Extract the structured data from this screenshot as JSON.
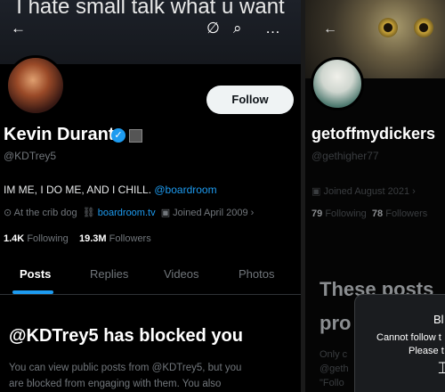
{
  "caption": "I hate small talk what u want",
  "left": {
    "header": {
      "back_icon": "←",
      "mute_icon": "∅",
      "search_icon": "⌕",
      "more_icon": "…"
    },
    "follow_label": "Follow",
    "name": "Kevin Durant",
    "verified_icon": "✓",
    "handle": "@KDTrey5",
    "bio_text": "IM ME, I DO ME, AND I CHILL.",
    "bio_mention": "@boardroom",
    "location": "At the crib dog",
    "website": "boardroom.tv",
    "joined": "Joined April 2009",
    "following_count": "1.4K",
    "following_label": "Following",
    "followers_count": "19.3M",
    "followers_label": "Followers",
    "tabs": [
      "Posts",
      "Replies",
      "Videos",
      "Photos"
    ],
    "blocked_title": "@KDTrey5 has blocked you",
    "blocked_body_l1": "You can view public posts from @KDTrey5, but you",
    "blocked_body_l2": "are blocked from engaging with them. You also"
  },
  "right": {
    "back_icon": "←",
    "name": "getoffmydickers",
    "handle": "@gethigher77",
    "joined": "Joined August 2021",
    "following_count": "79",
    "following_label": "Following",
    "followers_count": "78",
    "followers_label": "Followers",
    "big_line1": "These posts",
    "big_line2": "pro",
    "faint_l1": "Only c",
    "faint_l2": "@geth",
    "faint_l3": "\"Follo",
    "modal_title": "Bl",
    "modal_line1": "Cannot follow t",
    "modal_line2": "Please t"
  },
  "colors": {
    "accent": "#1d9bf0",
    "background": "#000000",
    "muted": "#71767b"
  }
}
